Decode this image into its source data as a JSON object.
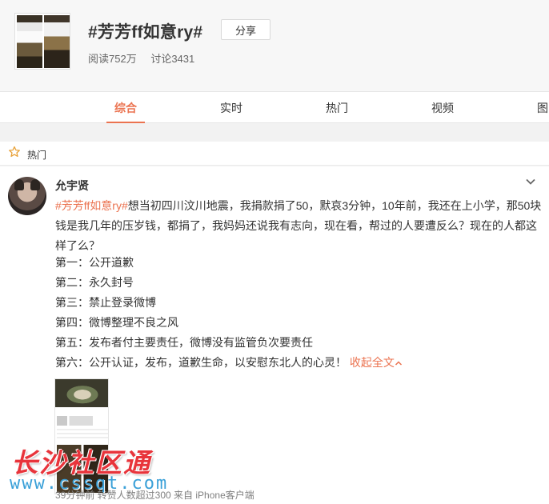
{
  "topic": {
    "title": "#芳芳ff如意ry#",
    "share_label": "分享",
    "reads": "阅读752万",
    "discussions": "讨论3431"
  },
  "tabs": [
    {
      "label": "综合",
      "active": true
    },
    {
      "label": "实时",
      "active": false
    },
    {
      "label": "热门",
      "active": false
    },
    {
      "label": "视频",
      "active": false
    },
    {
      "label": "图",
      "active": false
    }
  ],
  "hot_section": {
    "label": "热门",
    "icon": "star-icon"
  },
  "post": {
    "username": "允宇贤",
    "hashtag": "#芳芳ff如意ry#",
    "text": "想当初四川汶川地震，我捐款捐了50，默哀3分钟，10年前，我还在上小学，那50块钱是我几年的压岁钱，都捐了，我妈妈还说我有志向，现在看，帮过的人要遭反么？现在的人都这样了么？",
    "lines": [
      "第一：公开道歉",
      "第二：永久封号",
      "第三：禁止登录微博",
      "第四：微博整理不良之风",
      "第五：发布者付主要责任，微博没有监管负次要责任",
      "第六：公开认证，发布，道歉生命，以安慰东北人的心灵！"
    ],
    "collapse_label": "收起全文",
    "meta": "39分钟前 转赞人数超过300 来自 iPhone客户端"
  },
  "watermark": {
    "brand": "长沙社区通",
    "url": "www.cssqt.com"
  },
  "colors": {
    "accent": "#eb7350",
    "watermark_red": "#e8343b",
    "watermark_blue": "#3aa0d8"
  }
}
